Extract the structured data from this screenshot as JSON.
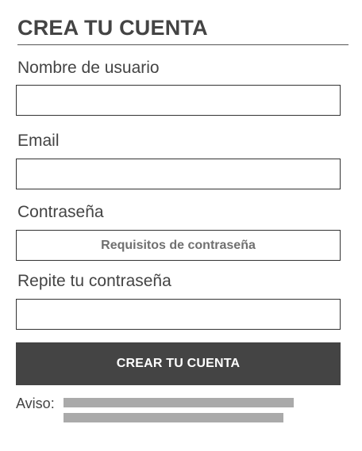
{
  "form": {
    "title": "CREA TU CUENTA",
    "username_label": "Nombre de usuario",
    "username_value": "",
    "email_label": "Email",
    "email_value": "",
    "password_label": "Contraseña",
    "password_requirements": "Requisitos de contraseña",
    "repeat_password_label": "Repite tu contraseña",
    "repeat_password_value": "",
    "submit_label": "CREAR TU CUENTA",
    "notice_label": "Aviso:"
  },
  "colors": {
    "text": "#444444",
    "button_background": "#444444",
    "button_text": "#ffffff",
    "placeholder_bar": "#aaaaaa"
  }
}
